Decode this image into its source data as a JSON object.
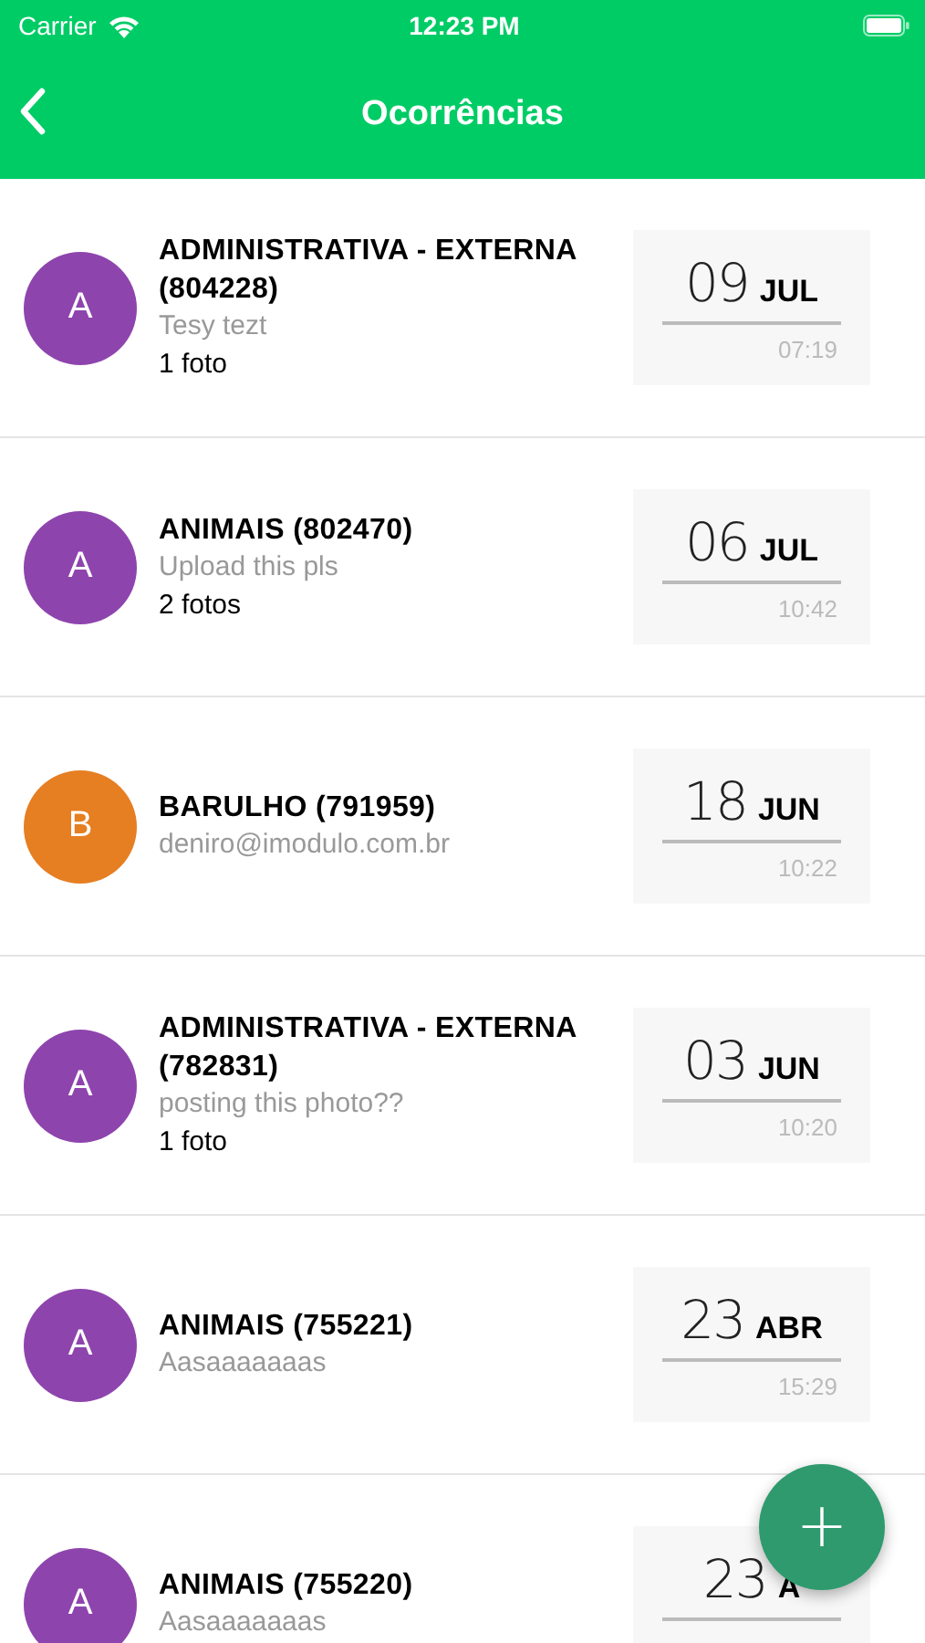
{
  "status_bar": {
    "carrier": "Carrier",
    "time": "12:23 PM"
  },
  "nav": {
    "title": "Ocorrências"
  },
  "items": [
    {
      "initial": "A",
      "color": "#8e44ad",
      "title": "ADMINISTRATIVA - EXTERNA (804228)",
      "description": "Tesy tezt",
      "photos": "1 foto",
      "day": "09",
      "month": "JUL",
      "time": "07:19"
    },
    {
      "initial": "A",
      "color": "#8e44ad",
      "title": "ANIMAIS (802470)",
      "description": "Upload this pls",
      "photos": "2 fotos",
      "day": "06",
      "month": "JUL",
      "time": "10:42"
    },
    {
      "initial": "B",
      "color": "#e67e22",
      "title": "BARULHO (791959)",
      "description": "deniro@imodulo.com.br",
      "day": "18",
      "month": "JUN",
      "time": "10:22"
    },
    {
      "initial": "A",
      "color": "#8e44ad",
      "title": "ADMINISTRATIVA - EXTERNA (782831)",
      "description": "posting this photo??",
      "photos": "1 foto",
      "day": "03",
      "month": "JUN",
      "time": "10:20"
    },
    {
      "initial": "A",
      "color": "#8e44ad",
      "title": "ANIMAIS (755221)",
      "description": "Aasaaaaaaas",
      "day": "23",
      "month": "ABR",
      "time": "15:29"
    },
    {
      "initial": "A",
      "color": "#8e44ad",
      "title": "ANIMAIS (755220)",
      "description": "Aasaaaaaaas",
      "day": "23",
      "month": "A"
    }
  ],
  "fab": {
    "label": "+"
  }
}
